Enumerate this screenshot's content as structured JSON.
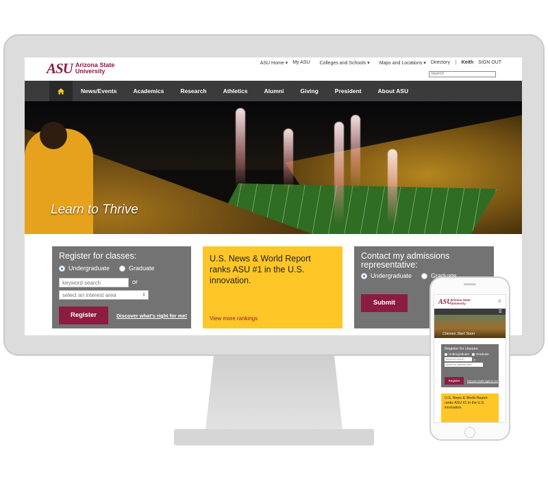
{
  "site": {
    "logo_mark": "ASU",
    "logo_name_line1": "Arizona State",
    "logo_name_line2": "University"
  },
  "utility_nav": {
    "items": [
      "ASU Home",
      "My ASU",
      "Colleges and Schools",
      "Maps and Locations",
      "Directory"
    ],
    "user": "Keith",
    "signout": "SIGN OUT",
    "search_placeholder": "Search"
  },
  "main_nav": {
    "home_icon": "home-icon",
    "items": [
      "News/Events",
      "Academics",
      "Research",
      "Athletics",
      "Alumni",
      "Giving",
      "President",
      "About ASU"
    ]
  },
  "hero": {
    "caption": "Learn to Thrive"
  },
  "register_card": {
    "title": "Register for classes:",
    "option_undergrad": "Undergraduate",
    "option_grad": "Graduate",
    "keyword_placeholder": "keyword search",
    "or_label": "or",
    "interest_placeholder": "select an interest area",
    "register_button": "Register",
    "discover_link": "Discover what's right for me!"
  },
  "news_card": {
    "text": "U.S. News & World Report ranks ASU #1 in the U.S. innovation.",
    "link": "View more rankings"
  },
  "contact_card": {
    "title": "Contact my admissions representative:",
    "option_undergrad": "Undergraduate",
    "option_grad": "Graduate",
    "submit_button": "Submit"
  },
  "phone": {
    "logo_mark": "ASU",
    "logo_name_line1": "Arizona State",
    "logo_name_line2": "University",
    "hero_caption": "Classes Start Soon",
    "register_title": "Register for classes:",
    "option_undergrad": "Undergraduate",
    "option_grad": "Graduate",
    "keyword_placeholder": "keyword search",
    "or_label": "or",
    "interest_placeholder": "select an interest area",
    "register_button": "Register",
    "discover_link": "Discover what's right for me!",
    "news_text": "U.S. News & World Report ranks ASU #1 in the U.S. innovation."
  },
  "colors": {
    "maroon": "#8c1d40",
    "gold": "#ffc627",
    "nav_dark": "#3b3b3b",
    "card_gray": "#737373"
  }
}
